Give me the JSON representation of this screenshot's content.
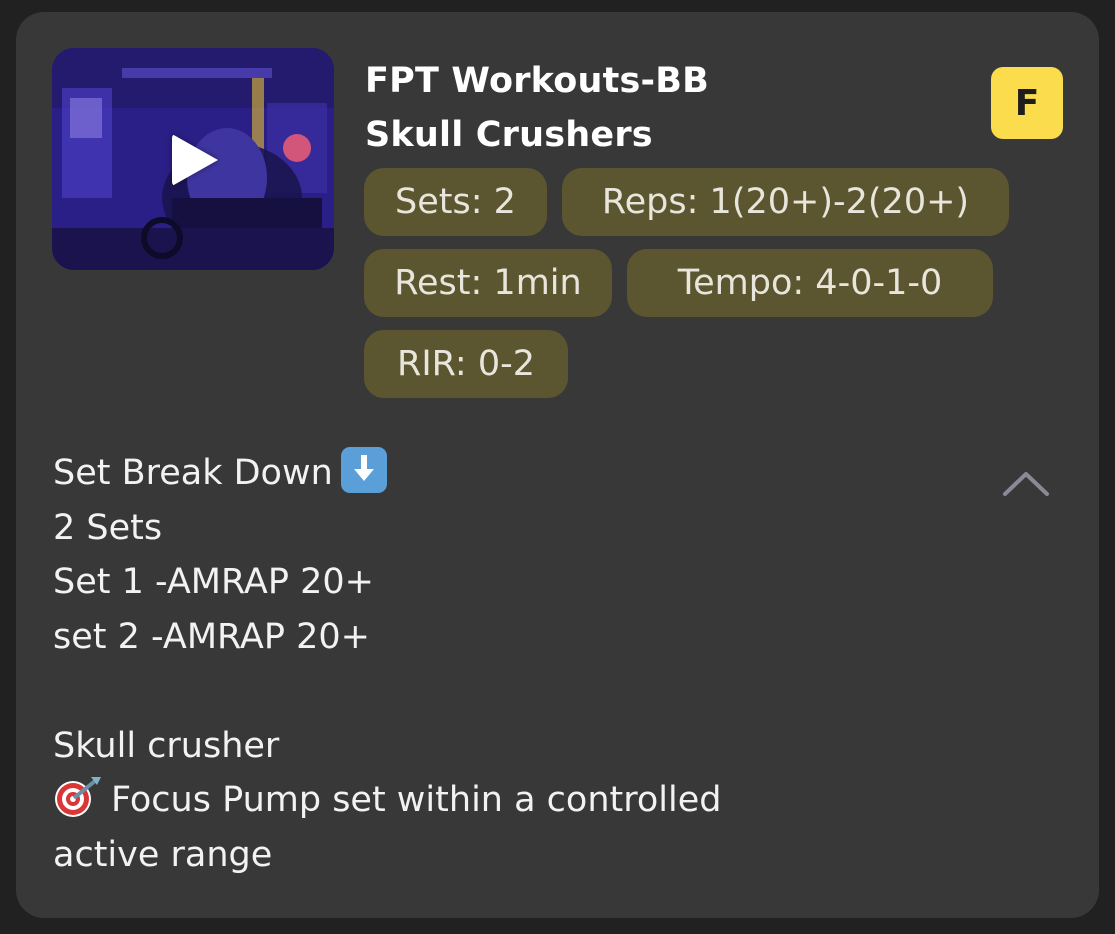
{
  "exercise": {
    "program": "FPT Workouts-BB",
    "name": "Skull Crushers",
    "avatar_letter": "F"
  },
  "params": {
    "sets": "Sets: 2",
    "reps": "Reps: 1(20+)-2(20+)",
    "rest": "Rest: 1min",
    "tempo": "Tempo: 4-0-1-0",
    "rir": "RIR: 0-2"
  },
  "description": {
    "line1": "Set Break Down",
    "line2": "2 Sets",
    "line3": "Set 1 -AMRAP 20+",
    "line4": "set 2 -AMRAP 20+",
    "line5": "Skull crusher",
    "line6": "Focus  Pump set within a controlled",
    "line7": "active range"
  },
  "icons": {
    "down_arrow": "down-arrow-emoji",
    "target": "direct-hit-emoji",
    "collapse": "chevron-up-icon",
    "play": "play-icon"
  },
  "colors": {
    "card_bg": "#383838",
    "pill_bg": "#5c5630",
    "avatar_bg": "#fbdc4c"
  }
}
